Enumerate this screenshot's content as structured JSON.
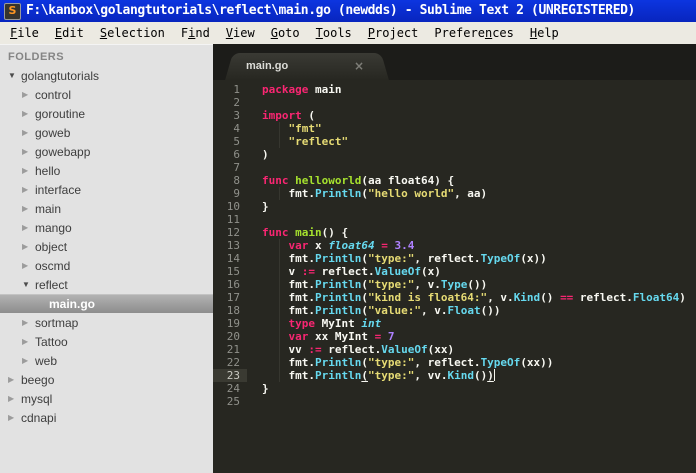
{
  "window": {
    "title": "F:\\kanbox\\golangtutorials\\reflect\\main.go (newdds) - Sublime Text 2 (UNREGISTERED)",
    "icon_glyph": "S"
  },
  "menu": {
    "items": [
      {
        "label": "File",
        "mnemonic_index": 0
      },
      {
        "label": "Edit",
        "mnemonic_index": 0
      },
      {
        "label": "Selection",
        "mnemonic_index": 0
      },
      {
        "label": "Find",
        "mnemonic_index": 1
      },
      {
        "label": "View",
        "mnemonic_index": 0
      },
      {
        "label": "Goto",
        "mnemonic_index": 0
      },
      {
        "label": "Tools",
        "mnemonic_index": 0
      },
      {
        "label": "Project",
        "mnemonic_index": 0
      },
      {
        "label": "Preferences",
        "mnemonic_index": 7
      },
      {
        "label": "Help",
        "mnemonic_index": 0
      }
    ]
  },
  "sidebar": {
    "header": "FOLDERS",
    "items": [
      {
        "label": "golangtutorials",
        "level": 0,
        "type": "folder",
        "state": "expanded"
      },
      {
        "label": "control",
        "level": 1,
        "type": "folder",
        "state": "collapsed"
      },
      {
        "label": "goroutine",
        "level": 1,
        "type": "folder",
        "state": "collapsed"
      },
      {
        "label": "goweb",
        "level": 1,
        "type": "folder",
        "state": "collapsed"
      },
      {
        "label": "gowebapp",
        "level": 1,
        "type": "folder",
        "state": "collapsed"
      },
      {
        "label": "hello",
        "level": 1,
        "type": "folder",
        "state": "collapsed"
      },
      {
        "label": "interface",
        "level": 1,
        "type": "folder",
        "state": "collapsed"
      },
      {
        "label": "main",
        "level": 1,
        "type": "folder",
        "state": "collapsed"
      },
      {
        "label": "mango",
        "level": 1,
        "type": "folder",
        "state": "collapsed"
      },
      {
        "label": "object",
        "level": 1,
        "type": "folder",
        "state": "collapsed"
      },
      {
        "label": "oscmd",
        "level": 1,
        "type": "folder",
        "state": "collapsed"
      },
      {
        "label": "reflect",
        "level": 1,
        "type": "folder",
        "state": "expanded"
      },
      {
        "label": "main.go",
        "level": 2,
        "type": "file",
        "selected": true
      },
      {
        "label": "sortmap",
        "level": 1,
        "type": "folder",
        "state": "collapsed"
      },
      {
        "label": "Tattoo",
        "level": 1,
        "type": "folder",
        "state": "collapsed"
      },
      {
        "label": "web",
        "level": 1,
        "type": "folder",
        "state": "collapsed"
      },
      {
        "label": "beego",
        "level": 0,
        "type": "folder",
        "state": "collapsed"
      },
      {
        "label": "mysql",
        "level": 0,
        "type": "folder",
        "state": "collapsed"
      },
      {
        "label": "cdnapi",
        "level": 0,
        "type": "folder",
        "state": "collapsed"
      }
    ]
  },
  "editor": {
    "tab": {
      "label": "main.go",
      "close_glyph": "×"
    },
    "current_line": 23,
    "lines": [
      {
        "n": 1,
        "tokens": [
          [
            "kw",
            "package"
          ],
          [
            "pl",
            " main"
          ]
        ]
      },
      {
        "n": 2,
        "tokens": []
      },
      {
        "n": 3,
        "tokens": [
          [
            "kw",
            "import"
          ],
          [
            "pl",
            " ("
          ]
        ]
      },
      {
        "n": 4,
        "guide": true,
        "tokens": [
          [
            "pl",
            "    "
          ],
          [
            "st",
            "\"fmt\""
          ]
        ]
      },
      {
        "n": 5,
        "guide": true,
        "tokens": [
          [
            "pl",
            "    "
          ],
          [
            "st",
            "\"reflect\""
          ]
        ]
      },
      {
        "n": 6,
        "tokens": [
          [
            "pl",
            ")"
          ]
        ]
      },
      {
        "n": 7,
        "tokens": []
      },
      {
        "n": 8,
        "tokens": [
          [
            "kw",
            "func"
          ],
          [
            "fn",
            " helloworld"
          ],
          [
            "pl",
            "(aa float64) {"
          ]
        ]
      },
      {
        "n": 9,
        "guide": true,
        "tokens": [
          [
            "pl",
            "    fmt."
          ],
          [
            "su",
            "Println"
          ],
          [
            "pl",
            "("
          ],
          [
            "st",
            "\"hello world\""
          ],
          [
            "pl",
            ", aa)"
          ]
        ]
      },
      {
        "n": 10,
        "tokens": [
          [
            "pl",
            "}"
          ]
        ]
      },
      {
        "n": 11,
        "tokens": []
      },
      {
        "n": 12,
        "tokens": [
          [
            "kw",
            "func"
          ],
          [
            "fn",
            " main"
          ],
          [
            "pl",
            "() {"
          ]
        ]
      },
      {
        "n": 13,
        "guide": true,
        "tokens": [
          [
            "kw",
            "    var"
          ],
          [
            "pl",
            " x "
          ],
          [
            "ty",
            "float64"
          ],
          [
            "pl",
            " "
          ],
          [
            "kw",
            "="
          ],
          [
            "pl",
            " "
          ],
          [
            "nu",
            "3.4"
          ]
        ]
      },
      {
        "n": 14,
        "guide": true,
        "tokens": [
          [
            "pl",
            "    fmt."
          ],
          [
            "su",
            "Println"
          ],
          [
            "pl",
            "("
          ],
          [
            "st",
            "\"type:\""
          ],
          [
            "pl",
            ", reflect."
          ],
          [
            "su",
            "TypeOf"
          ],
          [
            "pl",
            "(x))"
          ]
        ]
      },
      {
        "n": 15,
        "guide": true,
        "tokens": [
          [
            "pl",
            "    v "
          ],
          [
            "kw",
            ":="
          ],
          [
            "pl",
            " reflect."
          ],
          [
            "su",
            "ValueOf"
          ],
          [
            "pl",
            "(x)"
          ]
        ]
      },
      {
        "n": 16,
        "guide": true,
        "tokens": [
          [
            "pl",
            "    fmt."
          ],
          [
            "su",
            "Println"
          ],
          [
            "pl",
            "("
          ],
          [
            "st",
            "\"type:\""
          ],
          [
            "pl",
            ", v."
          ],
          [
            "su",
            "Type"
          ],
          [
            "pl",
            "())"
          ]
        ]
      },
      {
        "n": 17,
        "guide": true,
        "tokens": [
          [
            "pl",
            "    fmt."
          ],
          [
            "su",
            "Println"
          ],
          [
            "pl",
            "("
          ],
          [
            "st",
            "\"kind is float64:\""
          ],
          [
            "pl",
            ", v."
          ],
          [
            "su",
            "Kind"
          ],
          [
            "pl",
            "() "
          ],
          [
            "kw",
            "=="
          ],
          [
            "pl",
            " reflect."
          ],
          [
            "su",
            "Float64"
          ],
          [
            "pl",
            ")"
          ]
        ]
      },
      {
        "n": 18,
        "guide": true,
        "tokens": [
          [
            "pl",
            "    fmt."
          ],
          [
            "su",
            "Println"
          ],
          [
            "pl",
            "("
          ],
          [
            "st",
            "\"value:\""
          ],
          [
            "pl",
            ", v."
          ],
          [
            "su",
            "Float"
          ],
          [
            "pl",
            "())"
          ]
        ]
      },
      {
        "n": 19,
        "guide": true,
        "tokens": [
          [
            "kw",
            "    type"
          ],
          [
            "pl",
            " MyInt "
          ],
          [
            "ty",
            "int"
          ]
        ]
      },
      {
        "n": 20,
        "guide": true,
        "tokens": [
          [
            "kw",
            "    var"
          ],
          [
            "pl",
            " xx MyInt "
          ],
          [
            "kw",
            "="
          ],
          [
            "pl",
            " "
          ],
          [
            "nu",
            "7"
          ]
        ]
      },
      {
        "n": 21,
        "guide": true,
        "tokens": [
          [
            "pl",
            "    vv "
          ],
          [
            "kw",
            ":="
          ],
          [
            "pl",
            " reflect."
          ],
          [
            "su",
            "ValueOf"
          ],
          [
            "pl",
            "(xx)"
          ]
        ]
      },
      {
        "n": 22,
        "guide": true,
        "tokens": [
          [
            "pl",
            "    fmt."
          ],
          [
            "su",
            "Println"
          ],
          [
            "pl",
            "("
          ],
          [
            "st",
            "\"type:\""
          ],
          [
            "pl",
            ", reflect."
          ],
          [
            "su",
            "TypeOf"
          ],
          [
            "pl",
            "(xx))"
          ]
        ]
      },
      {
        "n": 23,
        "guide": true,
        "tokens": [
          [
            "pl",
            "    fmt."
          ],
          [
            "su",
            "Println"
          ],
          [
            "plu",
            "("
          ],
          [
            "st",
            "\"type:\""
          ],
          [
            "pl",
            ", vv."
          ],
          [
            "su",
            "Kind"
          ],
          [
            "pl",
            "()"
          ],
          [
            "plu",
            ")"
          ],
          [
            "cur",
            ""
          ]
        ]
      },
      {
        "n": 24,
        "tokens": [
          [
            "pl",
            "}"
          ]
        ]
      },
      {
        "n": 25,
        "tokens": []
      }
    ]
  },
  "colors": {
    "titlebar_bg_top": "#0c35e0",
    "titlebar_bg_bottom": "#0825be",
    "menubar_bg": "#eceae2",
    "sidebar_bg": "#e2e2e2",
    "sidebar_text": "#3d3d3d",
    "sidebar_header_text": "#858585",
    "selection_top": "#b2b2b2",
    "selection_bottom": "#8d8d8d",
    "selection_text": "#ffffff",
    "editor_bg": "#272721",
    "tabbar_bg": "#1c1c19",
    "tab_bg_top": "#3a3a34",
    "tab_text": "#dcdcd7",
    "gutter_text": "#90918b",
    "gutter_highlight_bg": "#3a3a32",
    "code_default": "#f8f8f2",
    "code_keyword": "#f92672",
    "code_function": "#a6e22e",
    "code_support": "#66d9ef",
    "code_type": "#66d9ef",
    "code_string": "#e6db74",
    "code_number": "#ae81ff"
  }
}
